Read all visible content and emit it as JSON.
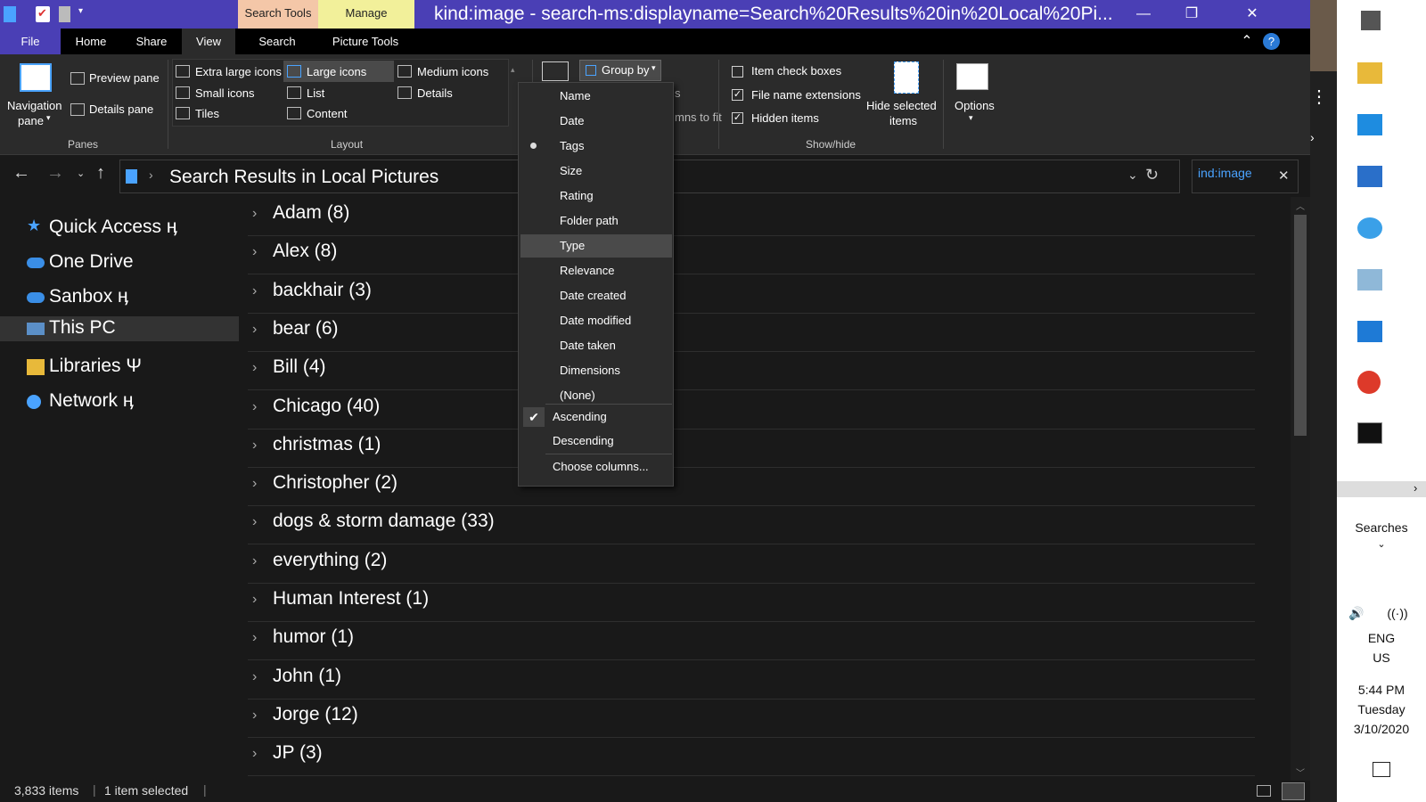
{
  "titlebar": {
    "title": "kind:image - search-ms:displayname=Search%20Results%20in%20Local%20Pi...",
    "context_tab_picture": "Search Tools",
    "context_tab_manage": "Manage",
    "minimize": "—",
    "maximize": "❐",
    "close": "✕"
  },
  "ribbon_tabs": {
    "file": "File",
    "home": "Home",
    "share": "Share",
    "view": "View",
    "search": "Search",
    "picture_tools": "Picture Tools",
    "collapse": "⌃",
    "help": "?"
  },
  "ribbon": {
    "panes": {
      "navigation_pane": "Navigation",
      "navigation_pane_line2": "pane",
      "preview_pane": "Preview pane",
      "details_pane": "Details pane",
      "group_label": "Panes"
    },
    "layout": {
      "extra_large_icons": "Extra large icons",
      "large_icons": "Large icons",
      "medium_icons": "Medium icons",
      "small_icons": "Small icons",
      "list": "List",
      "details": "Details",
      "tiles": "Tiles",
      "content": "Content",
      "group_label": "Layout"
    },
    "current_view": {
      "group_by": "Group by",
      "partial_s": "s",
      "partial_fit": "mns to fit"
    },
    "show_hide": {
      "item_check_boxes": "Item check boxes",
      "item_check_boxes_checked": false,
      "file_name_extensions": "File name extensions",
      "file_name_extensions_checked": true,
      "hidden_items": "Hidden items",
      "hidden_items_checked": true,
      "hide_selected_items": "Hide selected",
      "hide_selected_items_line2": "items",
      "options": "Options",
      "group_label": "Show/hide"
    }
  },
  "address": {
    "path": "Search Results in Local Pictures",
    "search_value": "ind:image",
    "search_clear": "✕"
  },
  "sidebar": {
    "items": [
      {
        "label": "Quick Access ӊ"
      },
      {
        "label": "One Drive"
      },
      {
        "label": "Sanbox ӊ"
      },
      {
        "label": "This PC"
      },
      {
        "label": "Libraries Ψ"
      },
      {
        "label": "Network ӊ"
      }
    ]
  },
  "groups": [
    "Adam (8)",
    "Alex (8)",
    "backhair (3)",
    "bear (6)",
    "Bill (4)",
    "Chicago (40)",
    "christmas (1)",
    "Christopher (2)",
    "dogs & storm damage (33)",
    "everything (2)",
    "Human Interest (1)",
    "humor (1)",
    "John (1)",
    "Jorge (12)",
    "JP (3)"
  ],
  "menu": {
    "items": [
      "Name",
      "Date",
      "Tags",
      "Size",
      "Rating",
      "Folder path",
      "Type",
      "Relevance",
      "Date created",
      "Date modified",
      "Date taken",
      "Dimensions",
      "(None)"
    ],
    "selected": "Tags",
    "highlighted": "Type",
    "ascending": "Ascending",
    "descending": "Descending",
    "ascending_checked": true,
    "choose_columns": "Choose columns..."
  },
  "status": {
    "item_count": "3,833 items",
    "selection": "1 item selected"
  },
  "taskbar": {
    "searches": "Searches",
    "lang1": "ENG",
    "lang2": "US",
    "time": "5:44 PM",
    "day": "Tuesday",
    "date": "3/10/2020"
  },
  "colors": {
    "titlebar": "#4a3fb5",
    "search_text": "#4aa3ff",
    "background": "#191919"
  }
}
